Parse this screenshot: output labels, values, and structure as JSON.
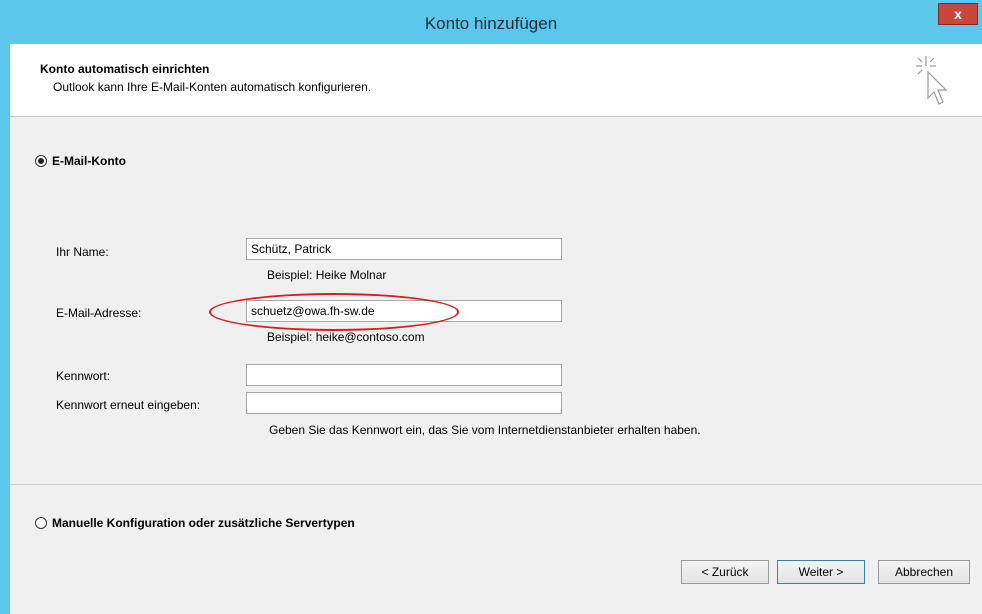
{
  "window": {
    "title": "Konto hinzufügen",
    "close_label": "x"
  },
  "header": {
    "title": "Konto automatisch einrichten",
    "subtitle": "Outlook kann Ihre E-Mail-Konten automatisch konfigurieren."
  },
  "options": {
    "email_account_label": "E-Mail-Konto",
    "email_account_selected": true,
    "manual_label": "Manuelle Konfiguration oder zusätzliche Servertypen",
    "manual_selected": false
  },
  "form": {
    "name_label": "Ihr Name:",
    "name_value": "Schütz, Patrick",
    "name_hint": "Beispiel: Heike Molnar",
    "email_label": "E-Mail-Adresse:",
    "email_value": "schuetz@owa.fh-sw.de",
    "email_hint": "Beispiel: heike@contoso.com",
    "password_label": "Kennwort:",
    "password_value": "",
    "password_repeat_label": "Kennwort erneut eingeben:",
    "password_repeat_value": "",
    "password_hint": "Geben Sie das Kennwort ein, das Sie vom Internetdienstanbieter erhalten haben."
  },
  "buttons": {
    "back": "< Zurück",
    "next": "Weiter >",
    "cancel": "Abbrechen"
  },
  "colors": {
    "titlebar": "#5bc7ea",
    "content_bg": "#f0f0f0",
    "annotation": "#d62020"
  }
}
